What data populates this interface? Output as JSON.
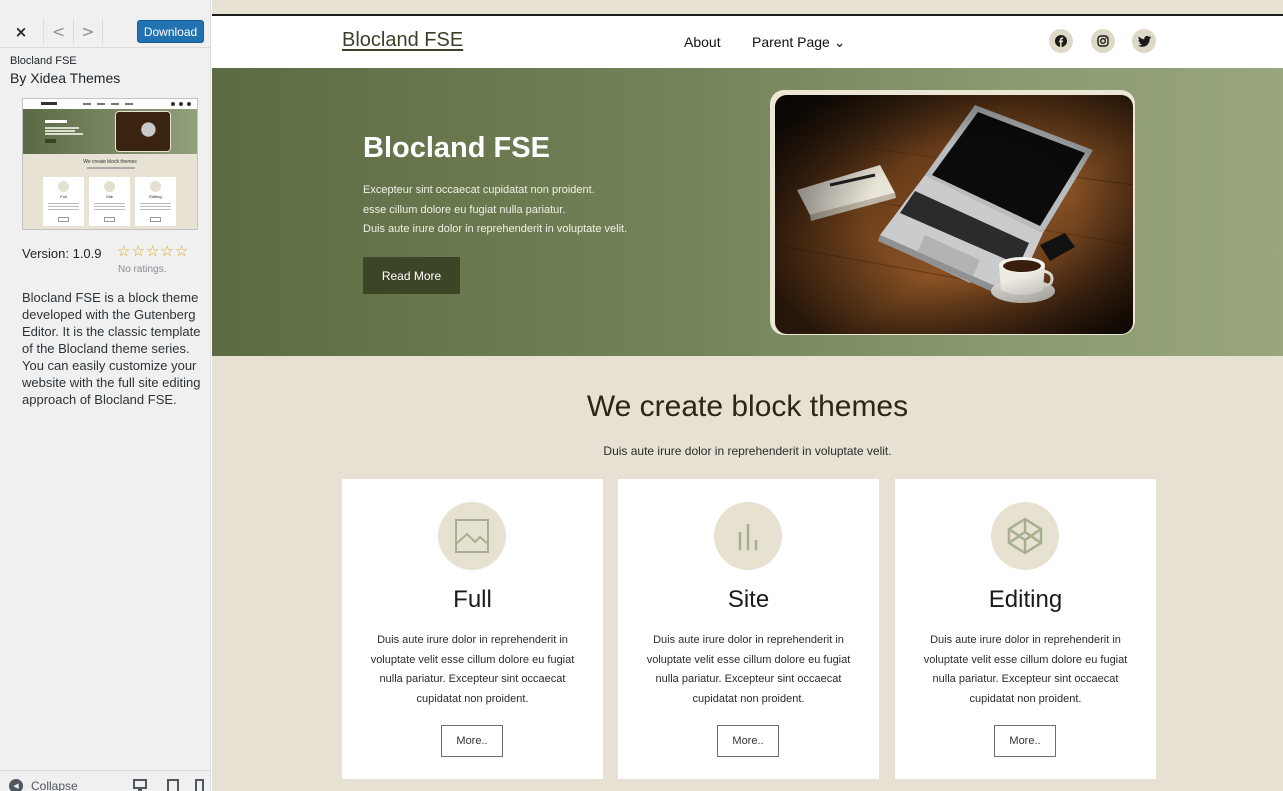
{
  "sidebar": {
    "close_label": "×",
    "prev_label": "<",
    "next_label": ">",
    "download_label": "Download",
    "theme_name": "Blocland FSE",
    "author": "By Xidea Themes",
    "thumbnail": {
      "hero_title": "Blocland FSE",
      "section_title": "We create block themes",
      "cards": [
        "Full",
        "Site",
        "Editing"
      ]
    },
    "version": "Version: 1.0.9",
    "stars": [
      "☆",
      "☆",
      "☆",
      "☆",
      "☆"
    ],
    "rating_count": 0,
    "ratings_text": "No ratings.",
    "description": "Blocland FSE is a block theme developed with the Gutenberg Editor. It is the classic template of the Blocland theme series. You can easily customize your website with the full site editing approach of Blocland FSE.",
    "collapse_label": "Collapse",
    "devices": [
      "desktop-icon",
      "tablet-icon",
      "mobile-icon"
    ]
  },
  "site": {
    "title": "Blocland FSE",
    "nav": {
      "about": "About",
      "parent": "Parent Page ⌄"
    },
    "social": [
      "facebook-icon",
      "instagram-icon",
      "twitter-icon"
    ],
    "hero": {
      "title": "Blocland FSE",
      "line1": "Excepteur sint occaecat cupidatat non proident.",
      "line2": "esse cillum dolore eu fugiat nulla pariatur.",
      "line3": "Duis aute irure dolor in reprehenderit in voluptate velit.",
      "button": "Read More"
    },
    "section": {
      "title": "We create block themes",
      "subtitle": "Duis aute irure dolor in reprehenderit in voluptate velit."
    },
    "cards": [
      {
        "icon": "image-icon",
        "title": "Full",
        "text": "Duis aute irure dolor in reprehenderit in voluptate velit esse cillum dolore eu fugiat nulla pariatur. Excepteur sint occaecat cupidatat non proident.",
        "button": "More.."
      },
      {
        "icon": "chart-bars-icon",
        "title": "Site",
        "text": "Duis aute irure dolor in reprehenderit in voluptate velit esse cillum dolore eu fugiat nulla pariatur. Excepteur sint occaecat cupidatat non proident.",
        "button": "More.."
      },
      {
        "icon": "codepen-icon",
        "title": "Editing",
        "text": "Duis aute irure dolor in reprehenderit in voluptate velit esse cillum dolore eu fugiat nulla pariatur. Excepteur sint occaecat cupidatat non proident.",
        "button": "More.."
      }
    ]
  },
  "colors": {
    "accent": "#2271b1",
    "hero_dark": "#5d6b44",
    "hero_light": "#98a57e",
    "button_dark": "#3d4527",
    "page_bg": "#e6e1d3",
    "icon_stroke": "#a6b08f"
  }
}
